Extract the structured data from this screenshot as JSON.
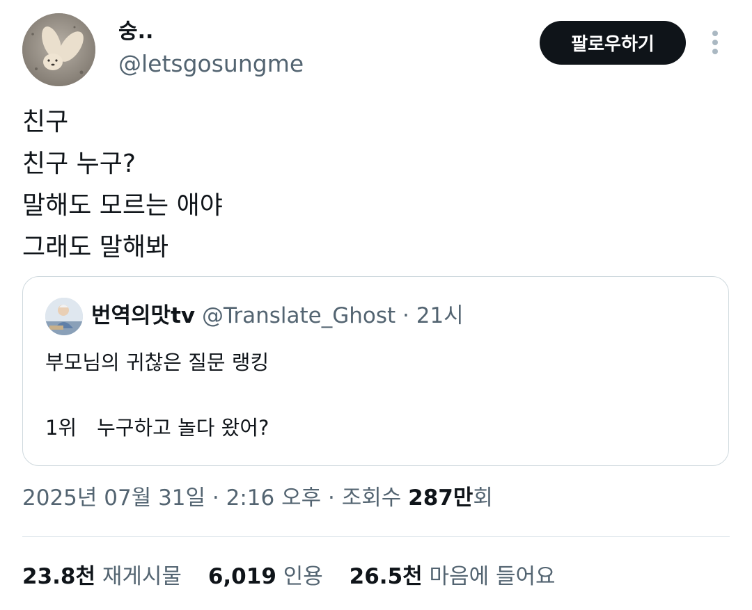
{
  "tweet": {
    "author": {
      "display_name": "숭..",
      "handle": "@letsgosungme"
    },
    "follow_label": "팔로우하기",
    "more_icon": "more-vertical-icon",
    "text_lines": [
      "친구",
      "친구 누구?",
      "말해도 모르는 애야",
      "그래도 말해봐"
    ],
    "quote": {
      "display_name": "번역의맛tv",
      "handle": "@Translate_Ghost",
      "separator": " · ",
      "time": "21시",
      "lines": [
        "부모님의 귀찮은 질문 랭킹",
        "1위　누구하고 놀다 왔어?"
      ]
    },
    "timestamp": {
      "date": "2025년 07월 31일",
      "sep1": " · ",
      "time": "2:16 오후",
      "sep2": " · ",
      "views_label": "조회수 ",
      "views_count": "287만",
      "views_suffix": "회"
    },
    "stats": {
      "retweets": {
        "count": "23.8천",
        "label": "재게시물"
      },
      "quotes": {
        "count": "6,019",
        "label": "인용"
      },
      "likes": {
        "count": "26.5천",
        "label": "마음에 들어요"
      }
    }
  }
}
